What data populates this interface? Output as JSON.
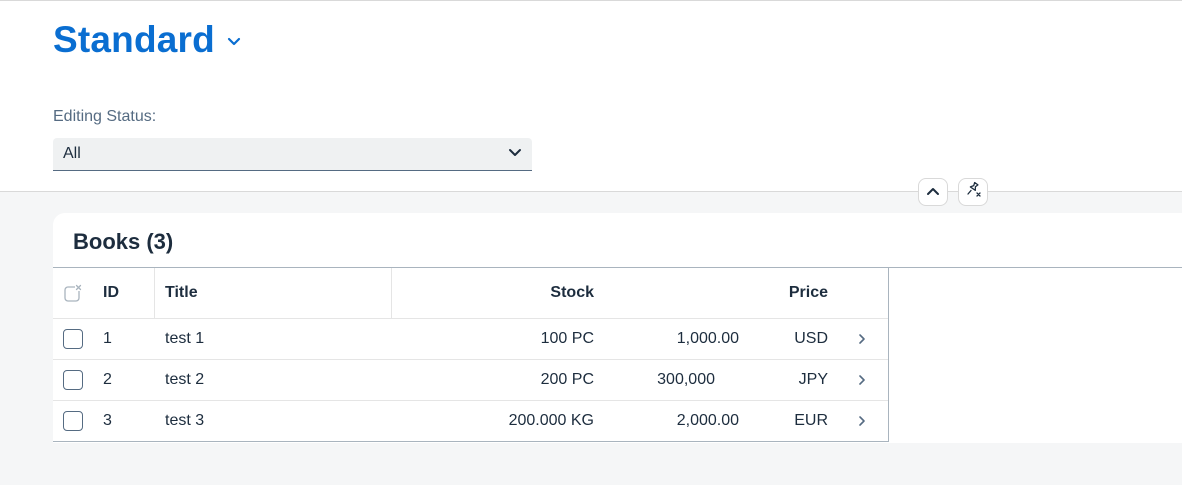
{
  "header": {
    "variant_title": "Standard",
    "filter": {
      "label": "Editing Status:",
      "selected": "All"
    }
  },
  "table": {
    "title": "Books (3)",
    "columns": {
      "id": "ID",
      "title": "Title",
      "stock": "Stock",
      "price": "Price"
    },
    "rows": [
      {
        "id": "1",
        "title": "test 1",
        "stock": "100 PC",
        "amount": "1,000.00",
        "currency": "USD"
      },
      {
        "id": "2",
        "title": "test 2",
        "stock": "200 PC",
        "amount": "300,000",
        "currency": "JPY"
      },
      {
        "id": "3",
        "title": "test 3",
        "stock": "200.000 KG",
        "amount": "2,000.00",
        "currency": "EUR"
      }
    ]
  },
  "icons": {
    "variant_menu": "chevron-down-icon",
    "select_dropdown": "chevron-down-icon",
    "collapse_header": "chevron-up-icon",
    "pin_header": "pin-icon",
    "clear_selection": "clear-selection-icon",
    "row_navigation": "chevron-right-icon"
  },
  "colors": {
    "brand_blue": "#0a6ed1",
    "text": "#1d2d3e",
    "muted_text": "#556b82",
    "background": "#f5f6f7"
  }
}
